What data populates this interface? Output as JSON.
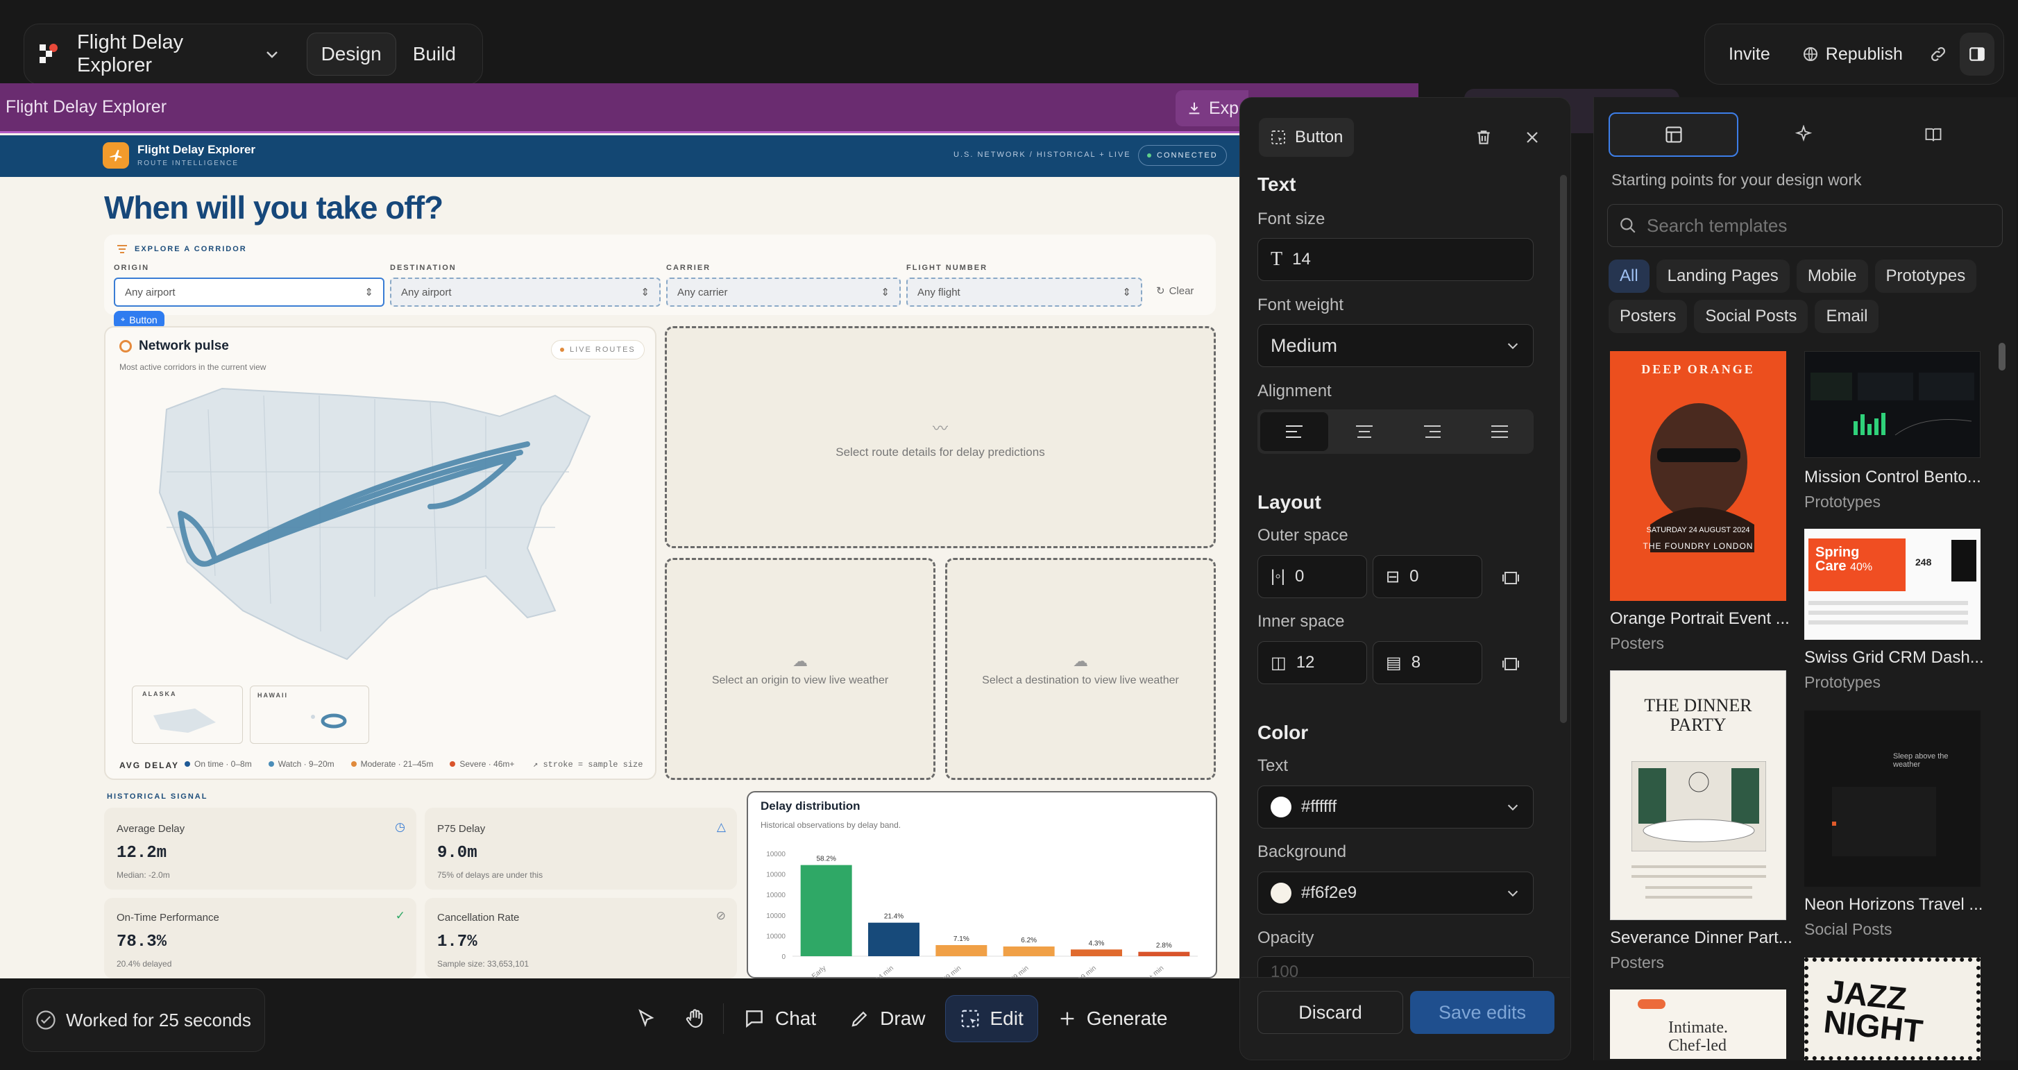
{
  "app": {
    "title": "Flight Delay Explorer",
    "mode_tabs": [
      "Design",
      "Build"
    ],
    "invite": "Invite",
    "republish": "Republish"
  },
  "preview": {
    "bar_title": "Flight Delay Explorer",
    "bar_export": "Expo",
    "site": {
      "brand": "Flight Delay Explorer",
      "brand_sub": "ROUTE INTELLIGENCE",
      "network": "U.S. NETWORK / HISTORICAL + LIVE",
      "connected": "CONNECTED",
      "headline": "When will you take off?",
      "corridor_label": "EXPLORE A CORRIDOR",
      "filters": [
        {
          "label": "ORIGIN",
          "value": "Any airport"
        },
        {
          "label": "DESTINATION",
          "value": "Any airport"
        },
        {
          "label": "CARRIER",
          "value": "Any carrier"
        },
        {
          "label": "FLIGHT NUMBER",
          "value": "Any flight"
        }
      ],
      "clear": "Clear",
      "button_tag": "Button",
      "network_pulse": "Network pulse",
      "network_pulse_sub": "Most active corridors in the current view",
      "live_routes": "LIVE ROUTES",
      "alaska": "ALASKA",
      "hawaii": "HAWAII",
      "avg_delay": "AVG DELAY",
      "legend": [
        "On time · 0–8m",
        "Watch · 9–20m",
        "Moderate · 21–45m",
        "Severe · 46m+"
      ],
      "legend_colors": [
        "#1f5a96",
        "#4b8db8",
        "#e08a3c",
        "#d9542b"
      ],
      "stroke_note": "stroke = sample size",
      "predict_placeholder": "Select route details for delay predictions",
      "origin_weather": "Select an origin to view live weather",
      "dest_weather": "Select a destination to view live weather",
      "historical_signal": "HISTORICAL SIGNAL",
      "stats": [
        {
          "title": "Average Delay",
          "value": "12.2m",
          "sub": "Median: -2.0m"
        },
        {
          "title": "P75 Delay",
          "value": "9.0m",
          "sub": "75% of delays are under this"
        },
        {
          "title": "On-Time Performance",
          "value": "78.3%",
          "sub": "20.4% delayed"
        },
        {
          "title": "Cancellation Rate",
          "value": "1.7%",
          "sub": "Sample size: 33,653,101"
        }
      ]
    }
  },
  "chart_data": {
    "type": "bar",
    "title": "Delay distribution",
    "subtitle": "Historical observations by delay band.",
    "categories": [
      "Early",
      "0–14 min",
      "15–29 min",
      "30–59 min",
      "60–119 min",
      "120+ min"
    ],
    "category_labels_visible": [
      "Early",
      "14 min",
      "29 min",
      "59 min",
      "119 min",
      "+ min"
    ],
    "values": [
      58.2,
      21.4,
      7.1,
      6.2,
      4.3,
      2.8
    ],
    "value_labels": [
      "58.2%",
      "21.4%",
      "7.1%",
      "6.2%",
      "4.3%",
      "2.8%"
    ],
    "colors": [
      "#2fa866",
      "#174a7a",
      "#f0a046",
      "#f0a046",
      "#e06a2e",
      "#d9542b"
    ],
    "y_ticks": [
      "10000",
      "10000",
      "10000",
      "10000",
      "10000",
      "0"
    ],
    "ylim": [
      0,
      70
    ]
  },
  "inspector": {
    "element": "Button",
    "text_section": "Text",
    "font_size_label": "Font size",
    "font_size": "14",
    "font_weight_label": "Font weight",
    "font_weight": "Medium",
    "alignment_label": "Alignment",
    "layout_section": "Layout",
    "outer_space_label": "Outer space",
    "outer_h": "0",
    "outer_v": "0",
    "inner_space_label": "Inner space",
    "inner_h": "12",
    "inner_v": "8",
    "color_section": "Color",
    "text_color_label": "Text",
    "text_color": "#ffffff",
    "bg_color_label": "Background",
    "bg_color": "#f6f2e9",
    "opacity_label": "Opacity",
    "opacity": "100",
    "discard": "Discard",
    "save": "Save edits"
  },
  "templates": {
    "subtitle": "Starting points for your design work",
    "search_placeholder": "Search templates",
    "filters": [
      "All",
      "Landing Pages",
      "Mobile",
      "Prototypes",
      "Posters",
      "Social Posts",
      "Email"
    ],
    "items": [
      {
        "name": "Orange Portrait Event ...",
        "category": "Posters"
      },
      {
        "name": "Mission Control Bento...",
        "category": "Prototypes"
      },
      {
        "name": "Swiss Grid CRM Dash...",
        "category": "Prototypes"
      },
      {
        "name": "Severance Dinner Part...",
        "category": "Posters"
      },
      {
        "name": "Neon Horizons Travel ...",
        "category": "Social Posts"
      }
    ],
    "poster1": {
      "top": "DEEP ORANGE",
      "date": "SATURDAY 24 AUGUST 2024",
      "venue": "THE FOUNDRY LONDON"
    },
    "poster_dinner": {
      "line1": "THE DINNER",
      "line2": "PARTY"
    },
    "crm": {
      "line1": "Spring",
      "line2": "Care",
      "pct": "40%",
      "num": "248"
    },
    "neon": {
      "text": "Sleep above the weather"
    },
    "intimate": {
      "text": "Intimate. Chef-led"
    },
    "jazz": {
      "text": "JAZZ NIGHT"
    }
  },
  "status": {
    "worked": "Worked for 25 seconds"
  },
  "toolbar": {
    "chat": "Chat",
    "draw": "Draw",
    "edit": "Edit",
    "generate": "Generate"
  }
}
